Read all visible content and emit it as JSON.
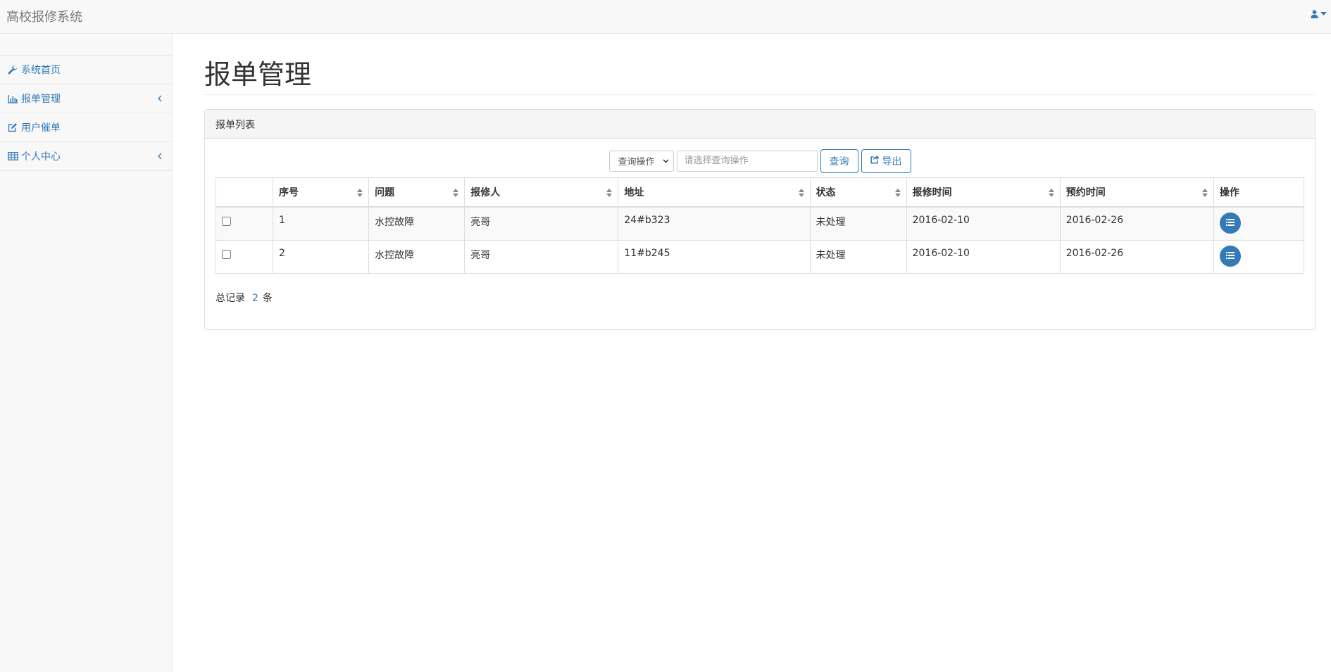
{
  "app": {
    "title": "高校报修系统"
  },
  "sidebar": {
    "items": [
      {
        "label": "系统首页",
        "icon": "wrench-icon",
        "has_chevron": false
      },
      {
        "label": "报单管理",
        "icon": "bar-chart-icon",
        "has_chevron": true
      },
      {
        "label": "用户催单",
        "icon": "edit-icon",
        "has_chevron": false
      },
      {
        "label": "个人中心",
        "icon": "table-icon",
        "has_chevron": true
      }
    ]
  },
  "main": {
    "page_title": "报单管理",
    "panel_title": "报单列表",
    "toolbar": {
      "select_value": "查询操作",
      "search_placeholder": "请选择查询操作",
      "query_label": "查询",
      "export_label": "导出"
    },
    "table": {
      "columns": [
        "序号",
        "问题",
        "报修人",
        "地址",
        "状态",
        "报修时间",
        "预约时间",
        "操作"
      ],
      "rows": [
        {
          "id": "1",
          "problem": "水控故障",
          "reporter": "亮哥",
          "address": "24#b323",
          "status": "未处理",
          "report_time": "2016-02-10",
          "appointment_time": "2016-02-26"
        },
        {
          "id": "2",
          "problem": "水控故障",
          "reporter": "亮哥",
          "address": "11#b245",
          "status": "未处理",
          "report_time": "2016-02-10",
          "appointment_time": "2016-02-26"
        }
      ]
    },
    "footer": {
      "total_label": "总记录",
      "total_count": "2",
      "unit_label": "条"
    }
  },
  "colors": {
    "accent": "#337ab7",
    "navbar_bg": "#f8f8f8",
    "border": "#dddddd"
  }
}
